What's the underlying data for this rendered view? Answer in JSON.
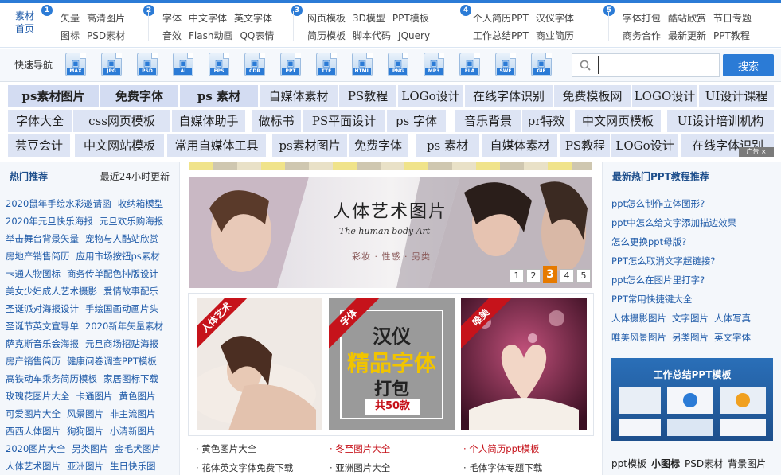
{
  "topnav": {
    "home": [
      "素材",
      "首页"
    ],
    "groups": [
      {
        "badge": "1",
        "row1": [
          "矢量",
          "高清图片"
        ],
        "row2": [
          "图标",
          "PSD素材"
        ]
      },
      {
        "badge": "2",
        "row1": [
          "字体",
          "中文字体",
          "英文字体"
        ],
        "row2": [
          "音效",
          "Flash动画",
          "QQ表情"
        ]
      },
      {
        "badge": "3",
        "row1": [
          "网页模板",
          "3D模型",
          "PPT模板"
        ],
        "row2": [
          "简历模板",
          "脚本代码",
          "JQuery"
        ]
      },
      {
        "badge": "4",
        "row1": [
          "个人简历PPT",
          "汉仪字体"
        ],
        "row2": [
          "工作总结PPT",
          "商业简历"
        ]
      },
      {
        "badge": "5",
        "row1": [
          "字体打包",
          "酷站欣赏",
          "节日专题"
        ],
        "row2": [
          "商务合作",
          "最新更新",
          "PPT教程"
        ]
      }
    ]
  },
  "quicknav": {
    "label": "快速导航",
    "icons": [
      {
        "name": "max-icon",
        "label": "MAX"
      },
      {
        "name": "jpg-icon",
        "label": "JPG"
      },
      {
        "name": "psd-icon",
        "label": "PSD"
      },
      {
        "name": "ai-icon",
        "label": "AI"
      },
      {
        "name": "eps-icon",
        "label": "EPS"
      },
      {
        "name": "cdr-icon",
        "label": "CDR"
      },
      {
        "name": "ppt-icon",
        "label": "PPT"
      },
      {
        "name": "ttf-icon",
        "label": "TTF"
      },
      {
        "name": "html-icon",
        "label": "HTML"
      },
      {
        "name": "png-icon",
        "label": "PNG"
      },
      {
        "name": "mp3-icon",
        "label": "MP3"
      },
      {
        "name": "fla-icon",
        "label": "FLA"
      },
      {
        "name": "swf-icon",
        "label": "SWF"
      },
      {
        "name": "gif-icon",
        "label": "GIF"
      }
    ]
  },
  "search": {
    "value": "",
    "button": "搜索"
  },
  "tagrows": [
    [
      "ps素材图片",
      "免费字体",
      "ps 素材",
      "自媒体素材",
      "PS教程",
      "LOGo设计",
      "在线字体识别",
      "免费模板网",
      "LOGO设计",
      "UI设计课程"
    ],
    [
      "字体大全",
      "css网页模板",
      "自媒体助手",
      "做标书",
      "PS平面设计",
      "ps 字体",
      "音乐背景",
      "pr特效",
      "中文网页模板",
      "UI设计培训机构"
    ],
    [
      "芸豆会计",
      "中文网站模板",
      "常用自媒体工具",
      "ps素材图片",
      "免费字体",
      "ps 素材",
      "自媒体素材",
      "PS教程",
      "LOGo设计",
      "在线字体识别"
    ]
  ],
  "ad_badge": "广告 ×",
  "left": {
    "title": "热门推荐",
    "subtitle": "最近24小时更新",
    "rows": [
      [
        "2020鼠年手绘水彩邀请函",
        "收纳箱模型"
      ],
      [
        "2020年元旦快乐海报",
        "元旦欢乐购海报"
      ],
      [
        "举击舞台背景矢量",
        "宠物与人酷站欣赏"
      ],
      [
        "房地产销售简历",
        "应用市场按钮ps素材"
      ],
      [
        "卡通人物图标",
        "商务传单配色排版设计"
      ],
      [
        "美女少妇成人艺术摄影",
        "爱情故事配乐"
      ],
      [
        "圣诞派对海报设计",
        "手绘国画动画片头"
      ],
      [
        "圣诞节英文宣导单",
        "2020新年矢量素材"
      ],
      [
        "萨克斯音乐会海报",
        "元旦商场招贴海报"
      ],
      [
        "房产销售简历",
        "健康问卷调查PPT模板"
      ],
      [
        "高铁动车乘务简历模板",
        "家居图标下载"
      ],
      [
        "玫瑰花图片大全",
        "卡通图片",
        "黄色图片"
      ],
      [
        "可爱图片大全",
        "风景图片",
        "非主流图片"
      ],
      [
        "西西人体图片",
        "狗狗图片",
        "小清新图片"
      ],
      [
        "2020图片大全",
        "另类图片",
        "金毛犬图片"
      ],
      [
        "人体艺术图片",
        "亚洲图片",
        "生日快乐图"
      ]
    ]
  },
  "banner": {
    "title": "人体艺术图片",
    "en": "The human body Art",
    "sub": "彩妆 · 性感 · 另类",
    "pages": [
      "1",
      "2",
      "3",
      "4",
      "5"
    ],
    "active_page": "3"
  },
  "cards": [
    {
      "ribbon": "人体艺术"
    },
    {
      "ribbon": "字体",
      "t1": "汉仪",
      "t2": "精品字体",
      "t3": "打包",
      "t4": "共50款"
    },
    {
      "ribbon": "唯美"
    }
  ],
  "center_links": {
    "row1": [
      "黄色图片大全",
      "冬至图片大全",
      "个人简历ppt模板"
    ],
    "row2": [
      "花体英文字体免费下载",
      "亚洲图片大全",
      "毛体字体专题下载"
    ]
  },
  "right": {
    "title": "最新热门PPT教程推荐",
    "links": [
      [
        "ppt怎么制作立体图形?"
      ],
      [
        "ppt中怎么给文字添加描边效果"
      ],
      [
        "怎么更换ppt母版?"
      ],
      [
        "PPT怎么取消文字超链接?"
      ],
      [
        "ppt怎么在图片里打字?"
      ],
      [
        "PPT常用快捷键大全"
      ],
      [
        "人体摄影图片",
        "文字图片",
        "人体写真"
      ],
      [
        "唯美风景图片",
        "另类图片",
        "英文字体"
      ]
    ],
    "thumb_title": "工作总结PPT模板",
    "tags": [
      "ppt模板",
      "小图标",
      "PSD素材",
      "背景图片"
    ]
  },
  "colors": {
    "accent": "#2b7bd6",
    "red": "#c6131b",
    "pager_active": "#e67a00"
  }
}
